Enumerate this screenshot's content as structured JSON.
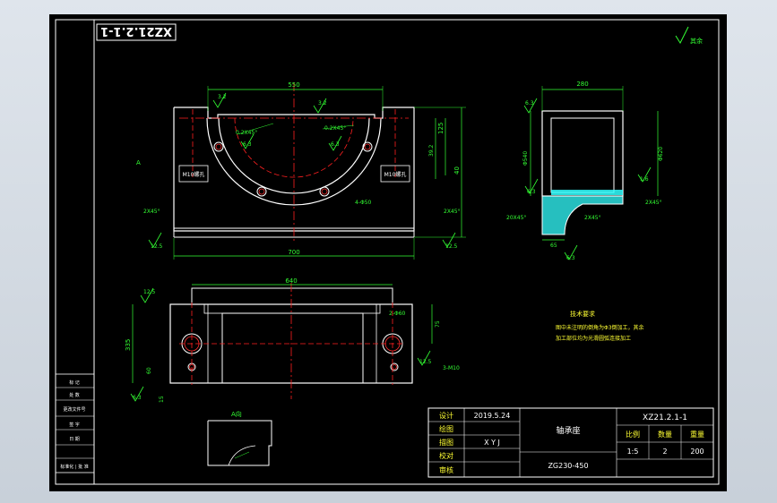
{
  "drawing_code_stamp": "XZ21.2.1-1",
  "roughness_other": "其余",
  "front_view": {
    "top_width": "550",
    "slot_depth": "125",
    "total_height": "40",
    "bottom_width": "700",
    "side_h": "39.2",
    "chamfer_small": "0.2X45°",
    "chamfer_big": "0.2X45°",
    "chamfer_left": "2X45°",
    "chamfer_right": "2X45°",
    "holes": "4-Φ50",
    "bolt_label_left": "M10螺孔",
    "bolt_label_right": "M10螺孔",
    "roughness": [
      "3.2",
      "6.3",
      "3.2",
      "6.3",
      "12.5",
      "12.5"
    ]
  },
  "side_view": {
    "width": "280",
    "height_left": "Φ540",
    "height_right": "Φ620",
    "chamfer_a": "2X45°",
    "chamfer_b": "20X45°",
    "chamfer_c": "2X45°",
    "dim_bottom": "65",
    "roughness": [
      "6.3",
      "6.3",
      "1.6",
      "6.3"
    ]
  },
  "top_view": {
    "width": "640",
    "height": "335",
    "hole_label": "2-Φ60",
    "right_dim": "75",
    "small_dim": "3-M10",
    "side_dims": [
      "60",
      "15"
    ],
    "roughness": [
      "12.5",
      "6.3",
      "12.5"
    ]
  },
  "detail": {
    "label": "A向"
  },
  "notes": {
    "title": "技术要求",
    "lines": [
      "图中未注明的倒角为Φ3倒加工，其余",
      "加工部位均为光滑圆弧连接加工"
    ]
  },
  "revision_table": {
    "rows": [
      "标 记",
      "处 数",
      "更改文件号",
      "签 字",
      "日 期",
      "标准化 | 批 准"
    ]
  },
  "title_block": {
    "rows": [
      {
        "label": "设计",
        "value": "2019.5.24"
      },
      {
        "label": "绘图",
        "value": ""
      },
      {
        "label": "描图",
        "value": "X Y J"
      },
      {
        "label": "校对",
        "value": ""
      },
      {
        "label": "审核",
        "value": ""
      }
    ],
    "part_name": "轴承座",
    "material": "ZG230-450",
    "drawing_no": "XZ21.2.1-1",
    "col_headers": [
      "比例",
      "数量",
      "重量"
    ],
    "col_values": [
      "1:5",
      "2",
      "200"
    ]
  }
}
